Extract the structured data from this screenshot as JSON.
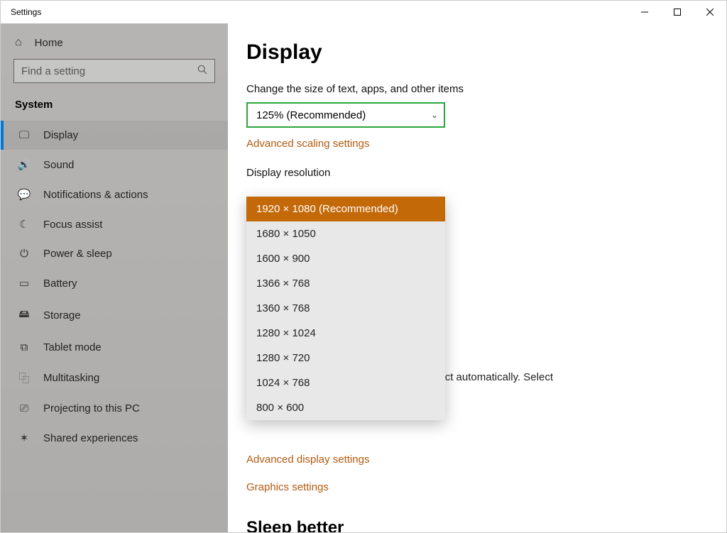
{
  "window": {
    "title": "Settings"
  },
  "sidebar": {
    "home": "Home",
    "search_placeholder": "Find a setting",
    "category": "System",
    "items": [
      {
        "icon": "🖵",
        "label": "Display",
        "active": true
      },
      {
        "icon": "🔊",
        "label": "Sound"
      },
      {
        "icon": "💬",
        "label": "Notifications & actions"
      },
      {
        "icon": "☾",
        "label": "Focus assist"
      },
      {
        "icon": "⏻",
        "label": "Power & sleep"
      },
      {
        "icon": "▭",
        "label": "Battery"
      },
      {
        "icon": "🖴",
        "label": "Storage"
      },
      {
        "icon": "⧉",
        "label": "Tablet mode"
      },
      {
        "icon": "⿻",
        "label": "Multitasking"
      },
      {
        "icon": "⎚",
        "label": "Projecting to this PC"
      },
      {
        "icon": "✶",
        "label": "Shared experiences"
      }
    ]
  },
  "main": {
    "title": "Display",
    "scale_label": "Change the size of text, apps, and other items",
    "scale_value": "125% (Recommended)",
    "scaling_link": "Advanced scaling settings",
    "resolution_label": "Display resolution",
    "resolution_options": [
      "1920 × 1080 (Recommended)",
      "1680 × 1050",
      "1600 × 900",
      "1366 × 768",
      "1360 × 768",
      "1280 × 1024",
      "1280 × 720",
      "1024 × 768",
      "800 × 600"
    ],
    "resolution_selected": "1920 × 1080 (Recommended)",
    "behind_fragment": "ct automatically. Select",
    "advanced_display_link": "Advanced display settings",
    "graphics_link": "Graphics settings",
    "next_section": "Sleep better"
  }
}
